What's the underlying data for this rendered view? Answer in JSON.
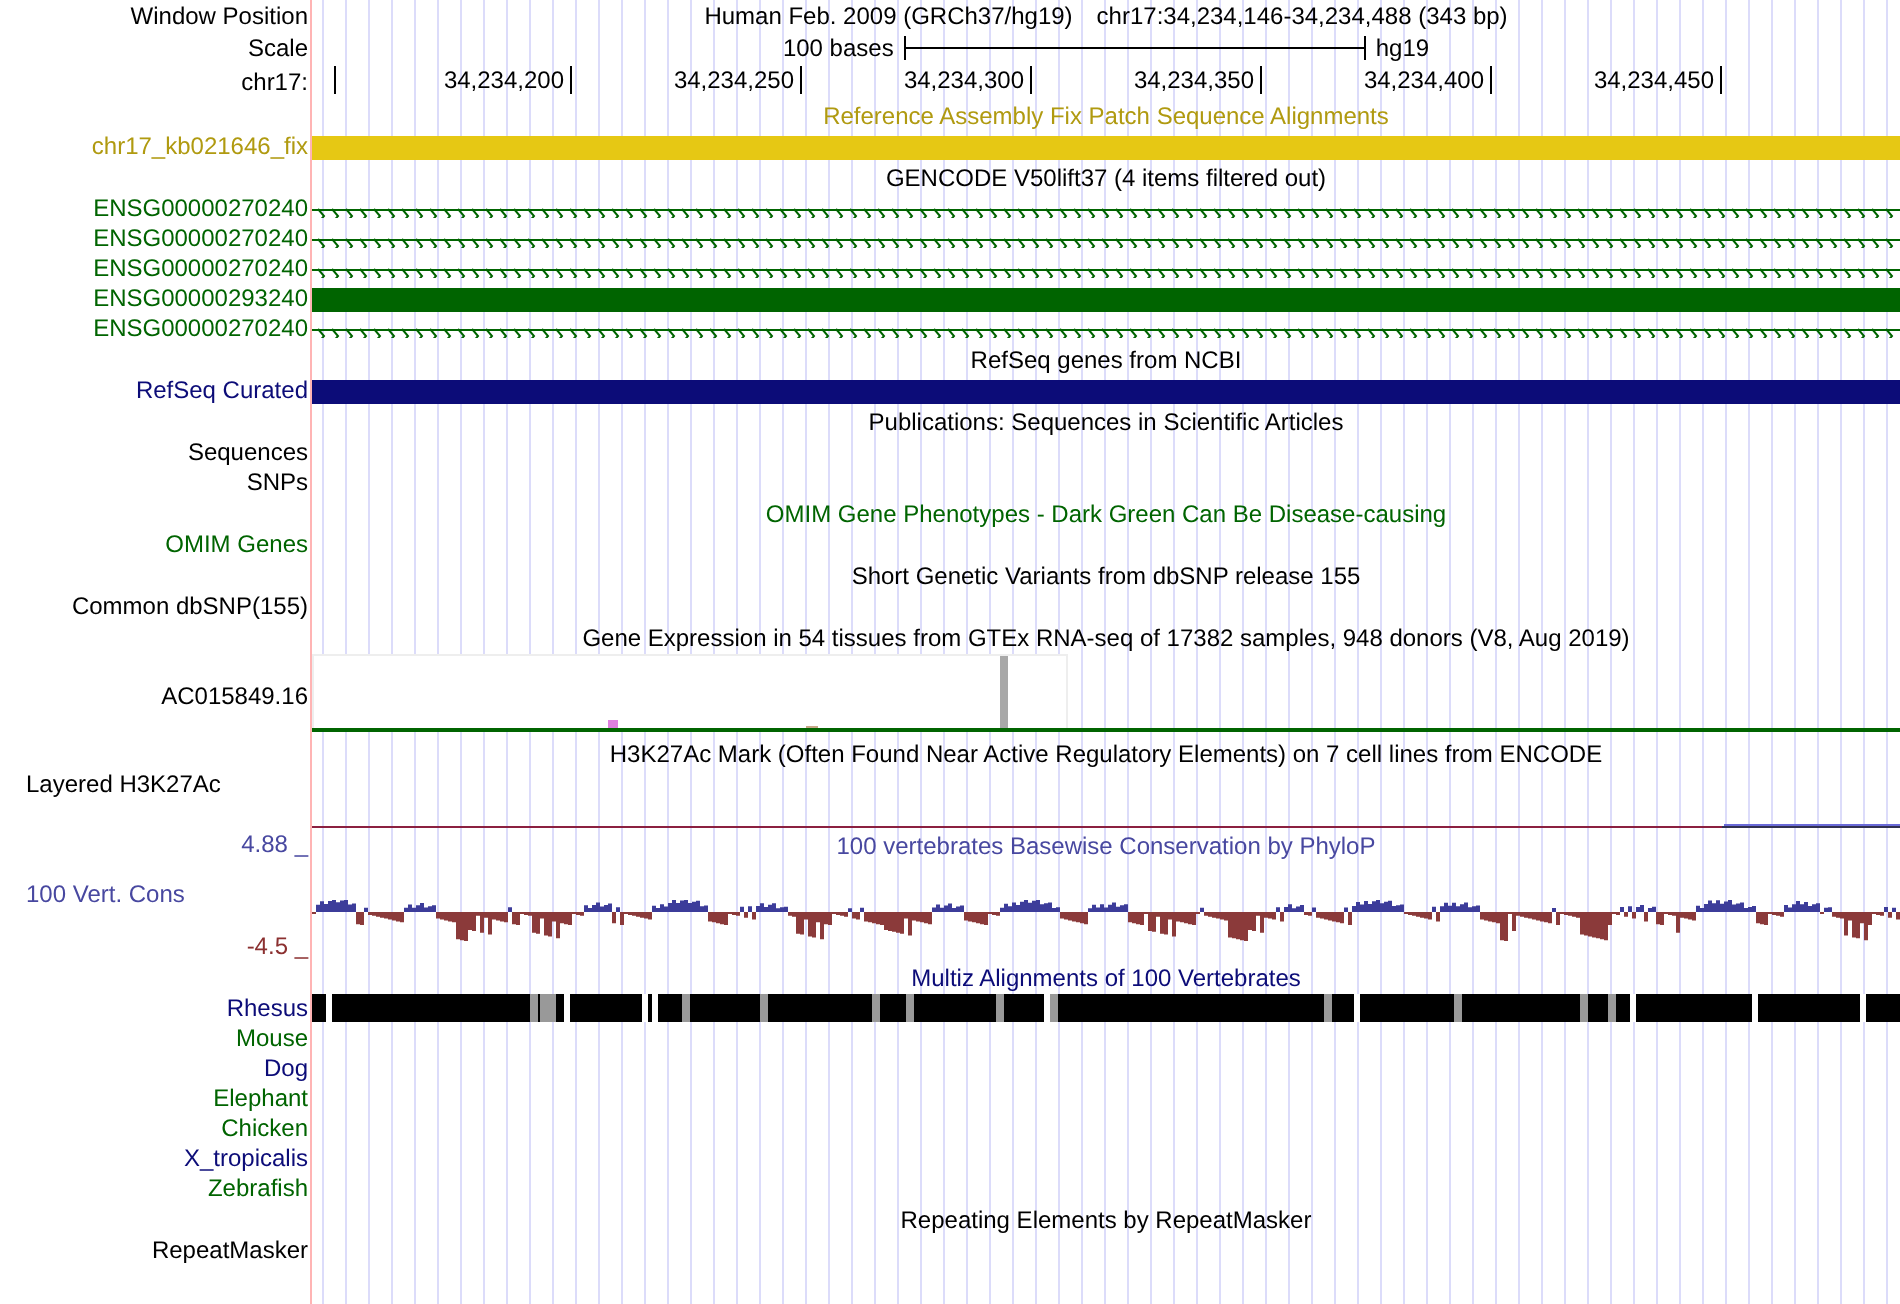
{
  "header": {
    "window_position_label": "Window Position",
    "assembly": "Human Feb. 2009 (GRCh37/hg19)",
    "position": "chr17:34,234,146-34,234,488 (343 bp)",
    "scale_label": "Scale",
    "scale_length": "100 bases",
    "scale_db": "hg19",
    "chrom_label": "chr17:",
    "ruler_ticks": [
      "34,234,200",
      "34,234,250",
      "34,234,300",
      "34,234,350",
      "34,234,400",
      "34,234,450"
    ]
  },
  "tracks": [
    {
      "kind": "features",
      "title": {
        "text": "Reference Assembly Fix Patch Sequence Alignments",
        "color": "#b09a10"
      },
      "rows": [
        {
          "label": {
            "text": "chr17_kb021646_fix",
            "color": "#b09a10"
          },
          "feature": {
            "kind": "block",
            "color": "#e6c814"
          }
        }
      ]
    },
    {
      "kind": "features",
      "title": {
        "text": "GENCODE V50lift37 (4 items filtered out)",
        "color": "#000000"
      },
      "rows": [
        {
          "label": {
            "text": "ENSG00000270240",
            "color": "#006400"
          },
          "feature": {
            "kind": "arrows",
            "color": "#006400"
          }
        },
        {
          "label": {
            "text": "ENSG00000270240",
            "color": "#006400"
          },
          "feature": {
            "kind": "arrows",
            "color": "#006400"
          }
        },
        {
          "label": {
            "text": "ENSG00000270240",
            "color": "#006400"
          },
          "feature": {
            "kind": "arrows",
            "color": "#006400"
          }
        },
        {
          "label": {
            "text": "ENSG00000293240",
            "color": "#006400"
          },
          "feature": {
            "kind": "block",
            "color": "#006400"
          }
        },
        {
          "label": {
            "text": "ENSG00000270240",
            "color": "#006400"
          },
          "feature": {
            "kind": "arrows",
            "color": "#006400"
          }
        }
      ]
    },
    {
      "kind": "features",
      "title": {
        "text": "RefSeq genes from NCBI",
        "color": "#000000"
      },
      "rows": [
        {
          "label": {
            "text": "RefSeq Curated",
            "color": "#0c0c78"
          },
          "feature": {
            "kind": "block",
            "color": "#0c0c78"
          }
        }
      ]
    },
    {
      "kind": "labels",
      "title": {
        "text": "Publications: Sequences in Scientific Articles",
        "color": "#000000"
      },
      "rows": [
        {
          "text": "Sequences",
          "color": "#000000"
        },
        {
          "text": "SNPs",
          "color": "#000000"
        }
      ]
    },
    {
      "kind": "labels",
      "title": {
        "text": "OMIM Gene Phenotypes - Dark Green Can Be Disease-causing",
        "color": "#006400"
      },
      "rows": [
        {
          "text": "OMIM Genes",
          "color": "#006400"
        }
      ]
    },
    {
      "kind": "labels",
      "title": {
        "text": "Short Genetic Variants from dbSNP release 155",
        "color": "#000000"
      },
      "rows": [
        {
          "text": "Common dbSNP(155)",
          "color": "#000000"
        }
      ]
    },
    {
      "kind": "gtex",
      "title": {
        "text": "Gene Expression in 54 tissues from GTEx RNA-seq of 17382 samples, 948 donors (V8, Aug 2019)",
        "color": "#000000"
      },
      "label": "AC015849.16"
    },
    {
      "kind": "layered",
      "title": {
        "text": "H3K27Ac Mark (Often Found Near Active Regulatory Elements) on 7 cell lines from ENCODE",
        "color": "#000000"
      },
      "label": "Layered H3K27Ac"
    },
    {
      "kind": "wiggle",
      "title": {
        "text": "100 vertebrates Basewise Conservation by PhyloP",
        "color": "#4848a0"
      },
      "upper": "4.88 _",
      "label": "100 Vert. Cons",
      "lower": "-4.5 _"
    },
    {
      "kind": "multiz",
      "title": {
        "text": "Multiz Alignments of 100 Vertebrates",
        "color": "#0c0c78"
      },
      "species": [
        {
          "label": "Rhesus",
          "color": "#0c0c78",
          "aligned": true
        },
        {
          "label": "Mouse",
          "color": "#006400",
          "aligned": false
        },
        {
          "label": "Dog",
          "color": "#0c0c78",
          "aligned": false
        },
        {
          "label": "Elephant",
          "color": "#006400",
          "aligned": false
        },
        {
          "label": "Chicken",
          "color": "#006400",
          "aligned": false
        },
        {
          "label": "X_tropicalis",
          "color": "#0c0c78",
          "aligned": false
        },
        {
          "label": "Zebrafish",
          "color": "#006400",
          "aligned": false
        }
      ]
    },
    {
      "kind": "labels",
      "title": {
        "text": "Repeating Elements by RepeatMasker",
        "color": "#000000"
      },
      "rows": [
        {
          "text": "RepeatMasker",
          "color": "#000000"
        }
      ]
    }
  ]
}
